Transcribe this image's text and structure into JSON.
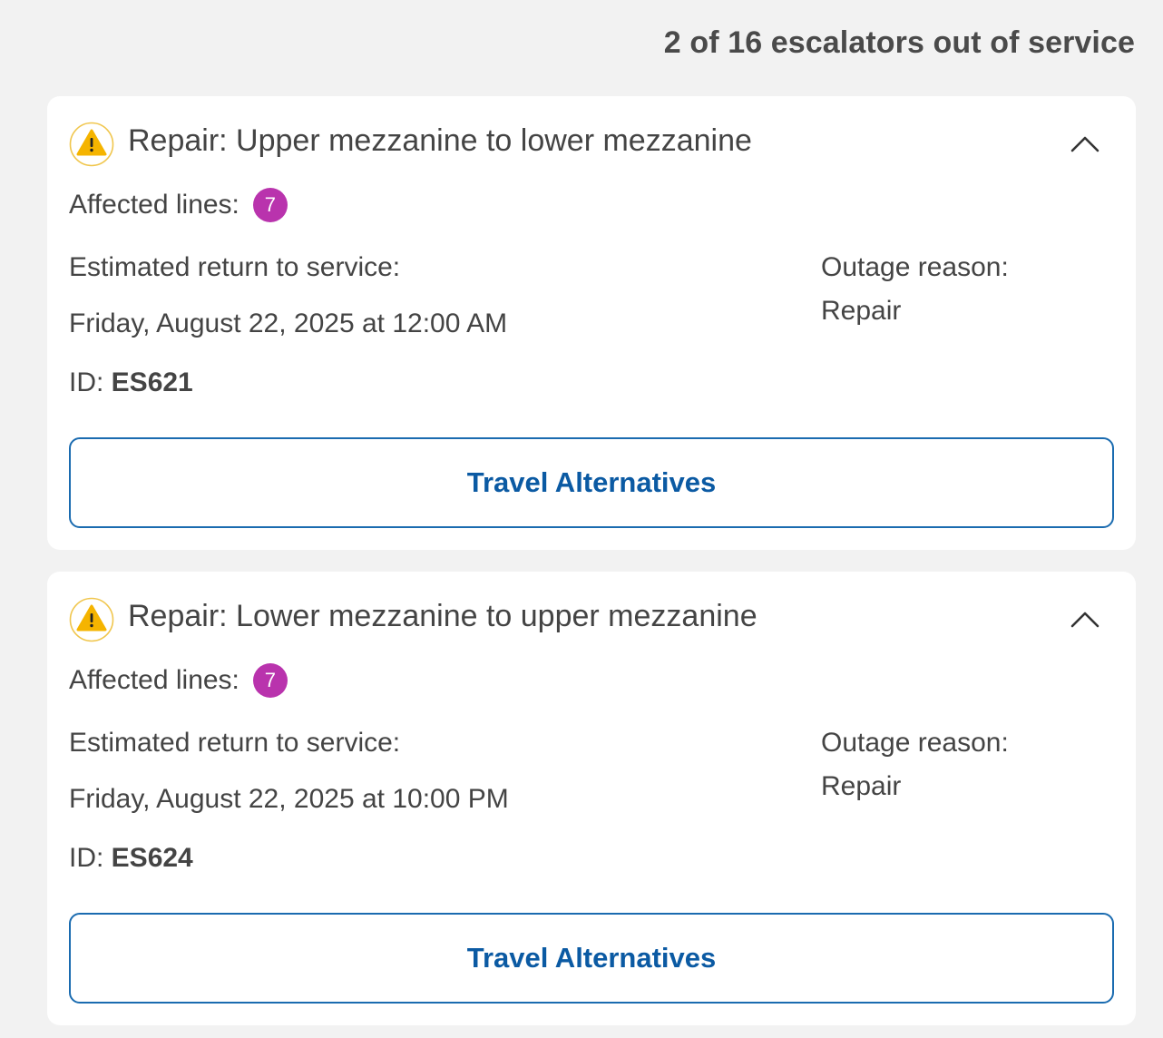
{
  "summary": "2 of 16 escalators out of service",
  "colors": {
    "line_7": "#b933ad",
    "warning_fill": "#f5b400",
    "warning_ring": "#f0c64d",
    "link_blue": "#0b5aa3"
  },
  "outages": [
    {
      "title": "Repair: Upper mezzanine to lower mezzanine",
      "affected_label": "Affected lines:",
      "line": "7",
      "ert_label": "Estimated return to service:",
      "ert_value": "Friday, August 22, 2025 at 12:00 AM",
      "id_label": "ID:",
      "id_value": "ES621",
      "outage_label": "Outage reason:",
      "outage_value": "Repair",
      "button_label": "Travel Alternatives",
      "icon": "warning-icon",
      "toggle_icon": "chevron-up-icon"
    },
    {
      "title": "Repair: Lower mezzanine to upper mezzanine",
      "affected_label": "Affected lines:",
      "line": "7",
      "ert_label": "Estimated return to service:",
      "ert_value": "Friday, August 22, 2025 at 10:00 PM",
      "id_label": "ID:",
      "id_value": "ES624",
      "outage_label": "Outage reason:",
      "outage_value": "Repair",
      "button_label": "Travel Alternatives",
      "icon": "warning-icon",
      "toggle_icon": "chevron-up-icon"
    }
  ]
}
